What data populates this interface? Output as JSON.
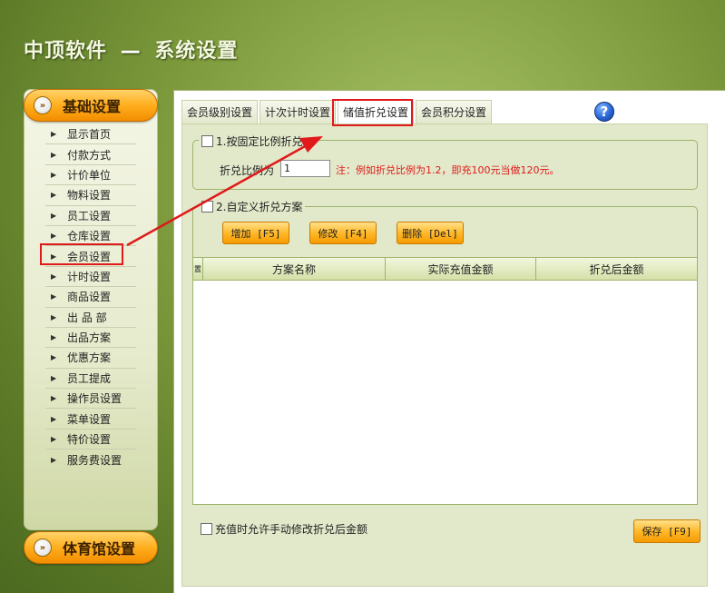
{
  "app": {
    "brand": "中顶软件",
    "separator": "—",
    "section": "系统设置"
  },
  "sidebar": {
    "top_group": "基础设置",
    "bottom_group": "体育馆设置",
    "items": [
      {
        "label": "显示首页"
      },
      {
        "label": "付款方式"
      },
      {
        "label": "计价单位"
      },
      {
        "label": "物料设置"
      },
      {
        "label": "员工设置"
      },
      {
        "label": "仓库设置"
      },
      {
        "label": "会员设置"
      },
      {
        "label": "计时设置"
      },
      {
        "label": "商品设置"
      },
      {
        "label": "出 品 部"
      },
      {
        "label": "出品方案"
      },
      {
        "label": "优惠方案"
      },
      {
        "label": "员工提成"
      },
      {
        "label": "操作员设置"
      },
      {
        "label": "菜单设置"
      },
      {
        "label": "特价设置"
      },
      {
        "label": "服务费设置"
      }
    ],
    "selected": "会员设置"
  },
  "tabs": [
    {
      "label": "会员级别设置"
    },
    {
      "label": "计次计时设置"
    },
    {
      "label": "储值折兑设置"
    },
    {
      "label": "会员积分设置"
    }
  ],
  "active_tab": "储值折兑设置",
  "help_icon": "?",
  "section1": {
    "legend": "1.按固定比例折兑",
    "ratio_label": "折兑比例为",
    "ratio_value": "1",
    "note": "注：例如折兑比例为1.2，即充100元当做120元。"
  },
  "section2": {
    "legend": "2.自定义折兑方案",
    "buttons": {
      "add": "增加 [F5]",
      "edit": "修改 [F4]",
      "delete": "删除 [Del]"
    },
    "grid": {
      "row_marker": "置",
      "columns": [
        "方案名称",
        "实际充值金额",
        "折兑后金额"
      ]
    }
  },
  "footer": {
    "allow_manual_edit": "充值时允许手动修改折兑后金额",
    "save": "保存 [F9]"
  },
  "colors": {
    "accent_orange": "#f59a00",
    "annotation_red": "#e0191b",
    "background_green": "#7d9a3c"
  }
}
